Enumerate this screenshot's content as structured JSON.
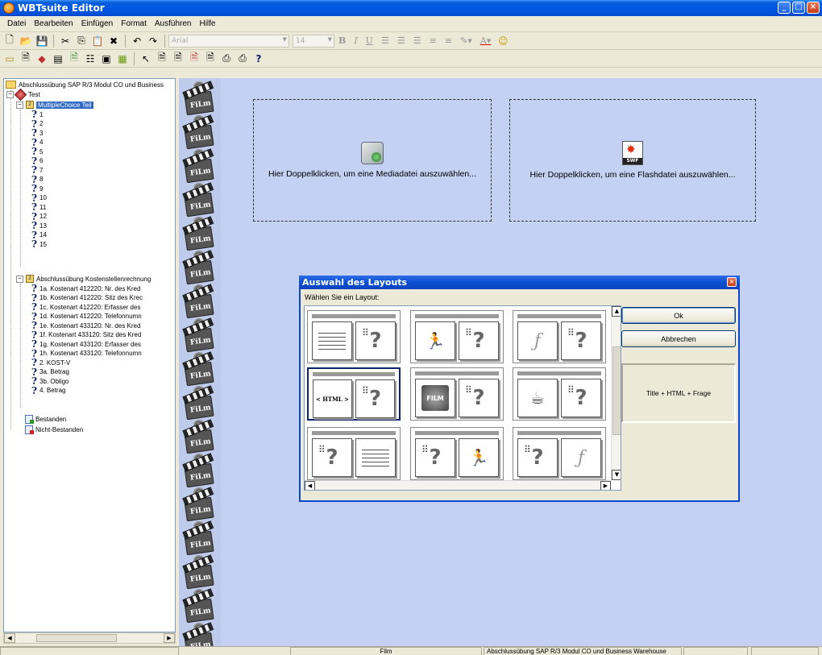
{
  "window": {
    "title": "WBTsuite Editor"
  },
  "menu": [
    "Datei",
    "Bearbeiten",
    "Einfügen",
    "Format",
    "Ausführen",
    "Hilfe"
  ],
  "format_toolbar": {
    "font": "Arial",
    "size": "14"
  },
  "tree": {
    "root": "Abschlussübung SAP R/3 Modul CO und Business",
    "test": "Test",
    "group1": {
      "label": "MultipleChoice Teil",
      "items": [
        "1",
        "2",
        "3",
        "4",
        "5",
        "6",
        "7",
        "8",
        "9",
        "10",
        "11",
        "12",
        "13",
        "14",
        "15"
      ]
    },
    "group2": {
      "label": "Abschlussübung Kostenstellenrechnung",
      "items": [
        "1a. Kostenart 412220: Nr. des Kred",
        "1b. Kostenart 412220: Sitz des Krec",
        "1c. Kostenart 412220: Erfasser des",
        "1d. Kostenart 412220: Telefonnumn",
        "1e. Kostenart 433120: Nr. des Kred",
        "1f. Kostenart 433120: Sitz des Kred",
        "1g. Kostenart 433120: Erfasser des",
        "1h. Kostenart 433120: Telefonnumn",
        "2. KOST-V",
        "3a. Betrag",
        "3b. Obligo",
        "4. Betrag"
      ]
    },
    "passed": "Bestanden",
    "failed": "Nicht-Bestanden"
  },
  "workarea": {
    "media_text": "Hier Doppelklicken, um eine Mediadatei auszuwählen...",
    "flash_text": "Hier Doppelklicken, um eine Flashdatei auszuwählen..."
  },
  "dialog": {
    "title": "Auswahl des Layouts",
    "prompt": "Wählen Sie ein Layout:",
    "ok": "Ok",
    "cancel": "Abbrechen",
    "preview": "Title + HTML + Frage",
    "html_cell": "< HTML >",
    "selected_index": 3
  },
  "statusbar": {
    "mode": "Film",
    "doc": "Abschlussübung SAP R/3 Modul CO und Business Warehouse"
  }
}
